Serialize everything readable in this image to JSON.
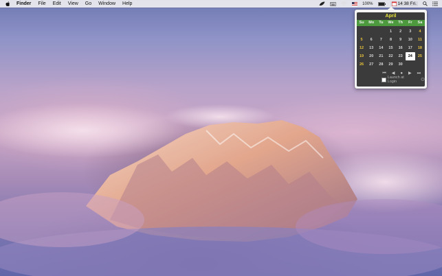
{
  "menubar": {
    "app_name": "Finder",
    "menus": [
      "File",
      "Edit",
      "View",
      "Go",
      "Window",
      "Help"
    ],
    "battery_percent": "100%",
    "clock_text": "14 38 Fri."
  },
  "calendar": {
    "month": "April",
    "weekdays": [
      "Su",
      "Mo",
      "Tu",
      "We",
      "Th",
      "Fr",
      "Sa"
    ],
    "days": [
      "",
      "",
      "",
      "1",
      "2",
      "3",
      "4",
      "5",
      "6",
      "7",
      "8",
      "9",
      "10",
      "11",
      "12",
      "13",
      "14",
      "15",
      "16",
      "17",
      "18",
      "19",
      "20",
      "21",
      "22",
      "23",
      "24",
      "25",
      "26",
      "27",
      "28",
      "29",
      "30",
      "",
      ""
    ],
    "today": "24",
    "nav": [
      "⏮",
      "◀",
      "●",
      "▶",
      "⏭"
    ],
    "launch_label": "Launch at Login",
    "colors": {
      "header_green": "#4c9a3d",
      "weekend_yellow": "#e9c23a",
      "month_yellow": "#e8e63a"
    }
  }
}
